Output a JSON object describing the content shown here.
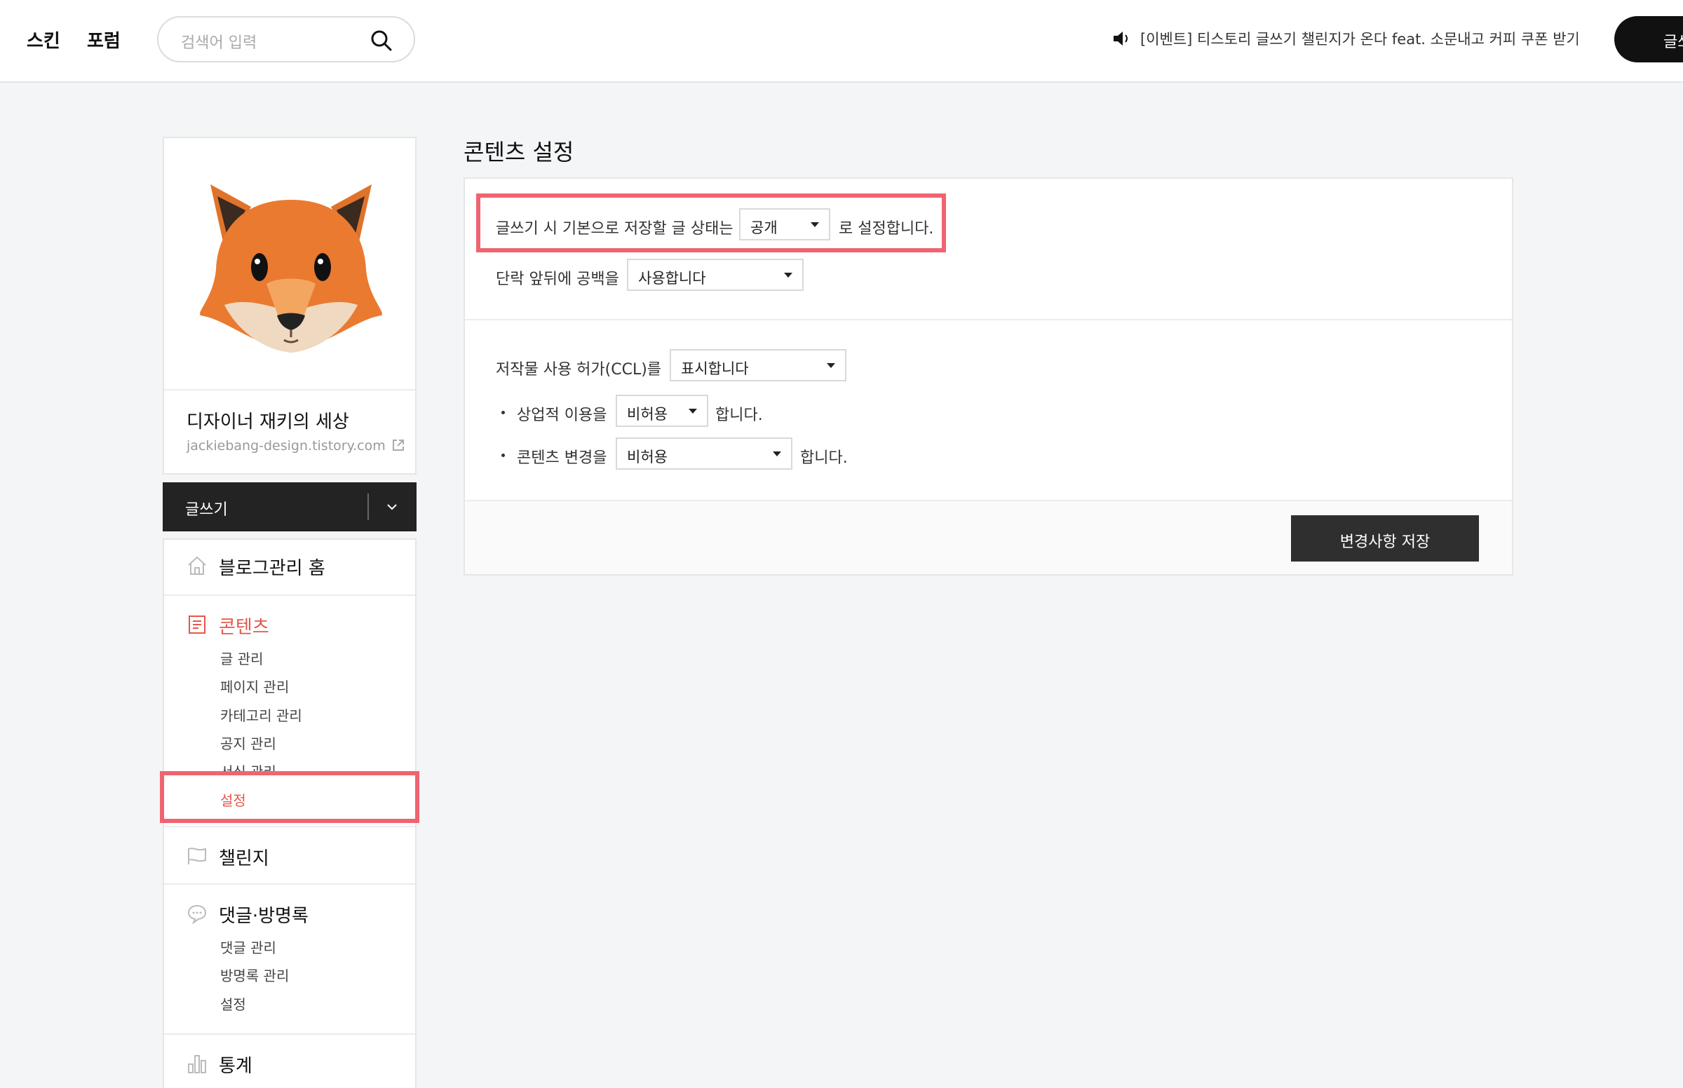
{
  "topbar": {
    "nav": [
      "스킨",
      "포럼"
    ],
    "search_placeholder": "검색어 입력",
    "notice": "[이벤트] 티스토리 글쓰기 챌린지가 온다 feat. 소문내고 커피 쿠폰 받기☕",
    "write_button": "글쓰기"
  },
  "profile": {
    "blog_name": "디자이너 재키의 세상",
    "blog_url": "jackiebang-design.tistory.com"
  },
  "sidebar": {
    "write_label": "글쓰기",
    "home": "블로그관리 홈",
    "contents": {
      "label": "콘텐츠",
      "items": [
        "글 관리",
        "페이지 관리",
        "카테고리 관리",
        "공지 관리",
        "서식 관리",
        "설정"
      ]
    },
    "challenge": "챌린지",
    "comments": {
      "label": "댓글·방명록",
      "items": [
        "댓글 관리",
        "방명록 관리",
        "설정"
      ]
    },
    "stats": "통계"
  },
  "page": {
    "title": "콘텐츠 설정",
    "default_status": {
      "prefix": "글쓰기 시 기본으로 저장할 글 상태는",
      "value": "공개",
      "suffix": "로 설정합니다."
    },
    "paragraph_spacing": {
      "label": "단락 앞뒤에 공백을",
      "value": "사용합니다"
    },
    "ccl": {
      "label": "저작물 사용 허가(CCL)를",
      "value": "표시합니다",
      "commercial": {
        "label": "상업적 이용을",
        "value": "비허용",
        "suffix": "합니다."
      },
      "modify": {
        "label": "콘텐츠 변경을",
        "value": "비허용",
        "suffix": "합니다."
      }
    },
    "save_button": "변경사항 저장"
  },
  "colors": {
    "accent": "#e4574a",
    "highlight": "#ef6470",
    "dark": "#232323"
  }
}
